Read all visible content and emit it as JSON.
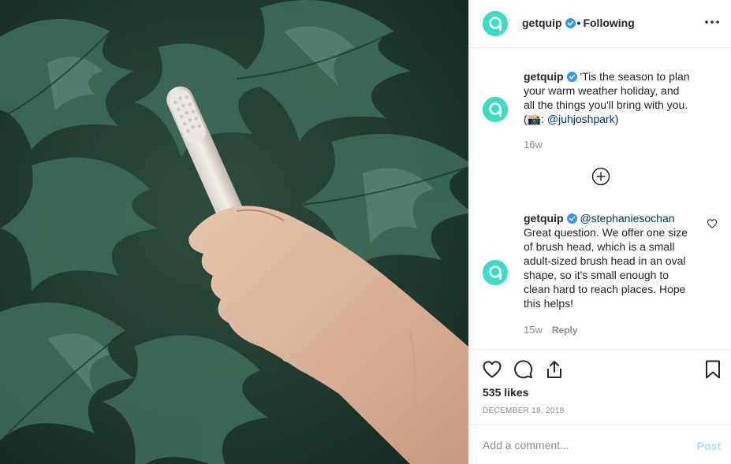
{
  "post": {
    "image_alt": "Hand holding a toothbrush in front of green leaves"
  },
  "header": {
    "username": "getquip",
    "separator": "•",
    "follow_status": "Following",
    "more_icon": "more-horizontal-icon"
  },
  "caption": {
    "username": "getquip",
    "text": "'Tis the season to plan your warm weather holiday, and all the things you'll bring with you. (📸: ",
    "mention": "@juhjoshpark",
    "closing": ")",
    "time": "16w"
  },
  "load_more_icon": "plus-circle-icon",
  "reply_comment": {
    "username": "getquip",
    "mention": "@stephaniesochan",
    "text": "Great question. We offer one size of brush head, which is a small adult-sized brush head in an oval shape, so it's small enough to clean hard to reach places. Hope this helps!",
    "time": "15w",
    "reply_label": "Reply"
  },
  "actions": {
    "like_icon": "heart-icon",
    "comment_icon": "comment-icon",
    "share_icon": "share-icon",
    "save_icon": "bookmark-icon"
  },
  "likes": "535 likes",
  "date": "DECEMBER 18, 2018",
  "comment_box": {
    "placeholder": "Add a comment...",
    "post_label": "Post"
  },
  "colors": {
    "brand_avatar": "#3ddcc2",
    "verified": "#3897f0",
    "mention": "#00376b",
    "post_disabled": "#b3dbff",
    "muted": "#8e8e8e"
  }
}
